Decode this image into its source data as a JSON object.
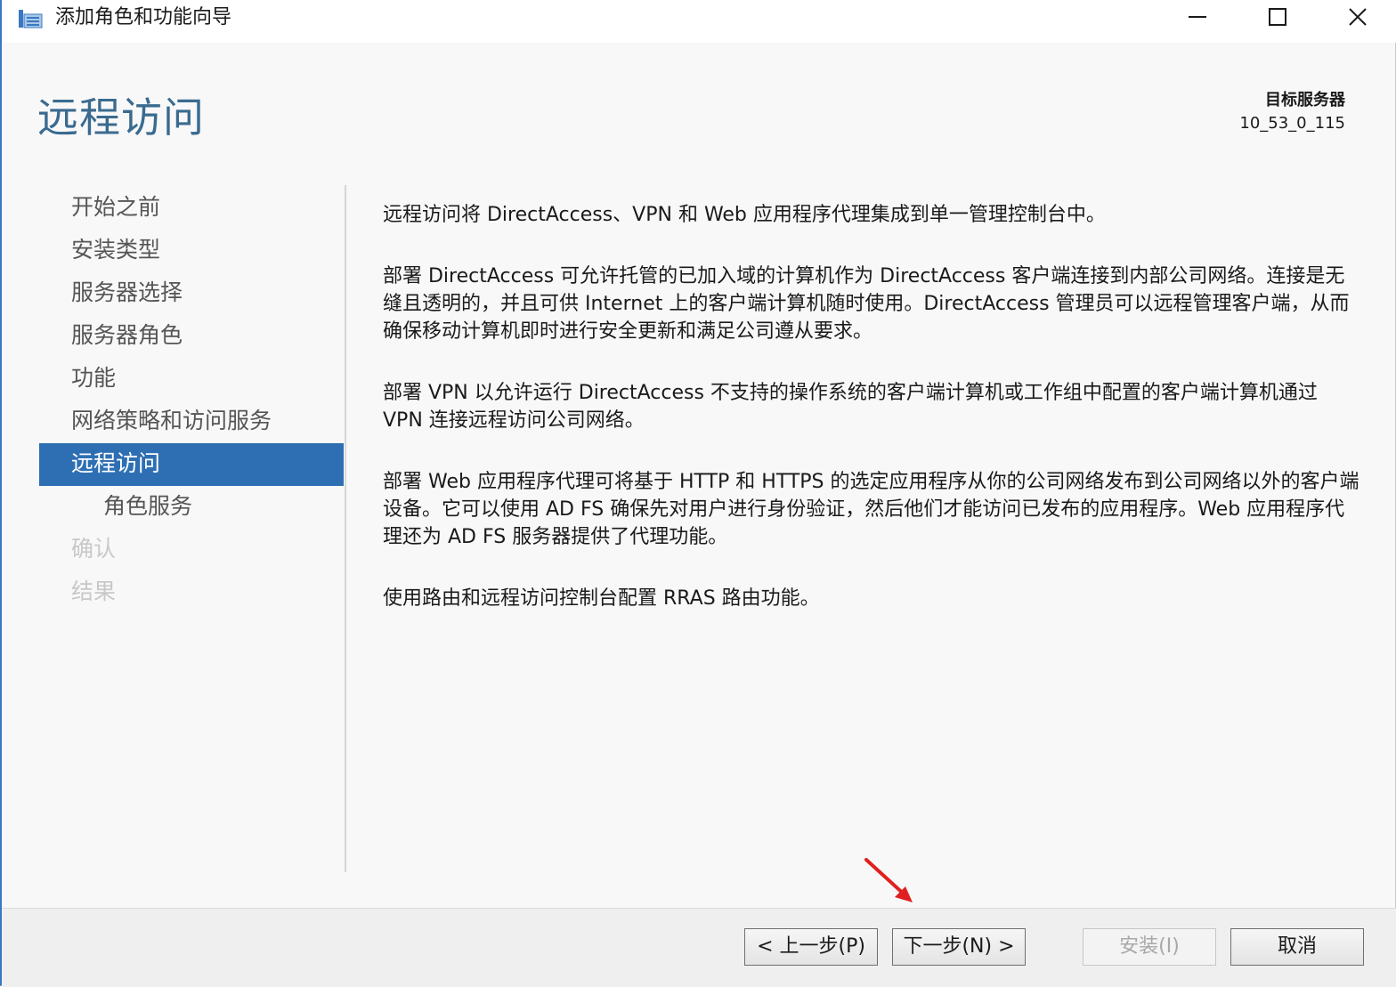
{
  "window": {
    "title": "添加角色和功能向导",
    "icon": "server-manager-wizard-icon"
  },
  "header": {
    "page_title": "远程访问",
    "target_label": "目标服务器",
    "target_value": "10_53_0_115"
  },
  "nav": {
    "items": [
      {
        "label": "开始之前",
        "state": "normal"
      },
      {
        "label": "安装类型",
        "state": "normal"
      },
      {
        "label": "服务器选择",
        "state": "normal"
      },
      {
        "label": "服务器角色",
        "state": "normal"
      },
      {
        "label": "功能",
        "state": "normal"
      },
      {
        "label": "网络策略和访问服务",
        "state": "normal"
      },
      {
        "label": "远程访问",
        "state": "active"
      },
      {
        "label": "角色服务",
        "state": "sub"
      },
      {
        "label": "确认",
        "state": "disabled"
      },
      {
        "label": "结果",
        "state": "disabled"
      }
    ]
  },
  "content": {
    "paragraphs": [
      "远程访问将 DirectAccess、VPN 和 Web 应用程序代理集成到单一管理控制台中。",
      "部署 DirectAccess 可允许托管的已加入域的计算机作为 DirectAccess 客户端连接到内部公司网络。连接是无缝且透明的，并且可供 Internet 上的客户端计算机随时使用。DirectAccess 管理员可以远程管理客户端，从而确保移动计算机即时进行安全更新和满足公司遵从要求。",
      "部署 VPN 以允许运行 DirectAccess 不支持的操作系统的客户端计算机或工作组中配置的客户端计算机通过 VPN 连接远程访问公司网络。",
      "部署 Web 应用程序代理可将基于 HTTP 和 HTTPS 的选定应用程序从你的公司网络发布到公司网络以外的客户端设备。它可以使用 AD FS 确保先对用户进行身份验证，然后他们才能访问已发布的应用程序。Web 应用程序代理还为 AD FS 服务器提供了代理功能。",
      "使用路由和远程访问控制台配置 RRAS 路由功能。"
    ]
  },
  "footer": {
    "prev_label": "< 上一步(P)",
    "next_label": "下一步(N) >",
    "install_label": "安装(I)",
    "cancel_label": "取消"
  },
  "colors": {
    "accent": "#2e6fb4",
    "title": "#3a6b8f",
    "annotation_arrow": "#e02020"
  }
}
